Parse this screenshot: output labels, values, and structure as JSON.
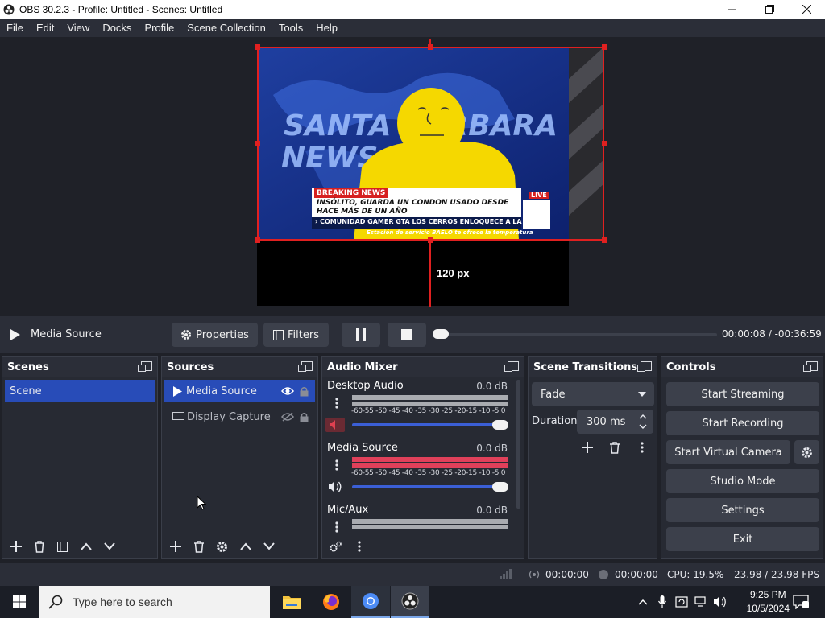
{
  "window": {
    "title": "OBS 30.2.3 - Profile: Untitled - Scenes: Untitled"
  },
  "menu": [
    "File",
    "Edit",
    "View",
    "Docks",
    "Profile",
    "Scene Collection",
    "Tools",
    "Help"
  ],
  "preview": {
    "distance_label": "120 px",
    "scene_text": {
      "headline1": "SANTA BARBARA",
      "headline2": "NEWS",
      "breaking": "BREAKING NEWS",
      "ticker1": "INSÓLITO, GUARDA UN CONDON USADO DESDE",
      "ticker2": "HACE MÁS DE UN AÑO",
      "ticker3": "› COMUNIDAD GAMER  GTA LOS CERROS ENLOQUECE A LA COM",
      "live": "LIVE",
      "sponsor": "Estación de servicio  BAELO  te ofrece la temperatura"
    }
  },
  "media_bar": {
    "source_name": "Media Source",
    "properties_label": "Properties",
    "filters_label": "Filters",
    "time": "00:00:08  /  -00:36:59",
    "progress": 0.0036
  },
  "scenes": {
    "title": "Scenes",
    "items": [
      "Scene"
    ]
  },
  "sources": {
    "title": "Sources",
    "items": [
      "Media Source",
      "Display Capture"
    ]
  },
  "audio_mixer": {
    "title": "Audio Mixer",
    "ticks": "-60-55 -50 -45 -40 -35 -30 -25 -20-15 -10 -5  0",
    "channels": [
      {
        "name": "Desktop Audio",
        "db": "0.0 dB",
        "muted": true,
        "volume": 1.0
      },
      {
        "name": "Media Source",
        "db": "0.0 dB",
        "muted": false,
        "volume": 1.0
      },
      {
        "name": "Mic/Aux",
        "db": "0.0 dB",
        "muted": false,
        "volume": 1.0
      }
    ]
  },
  "transitions": {
    "title": "Scene Transitions",
    "selected": "Fade",
    "duration_label": "Duration",
    "duration_value": "300 ms"
  },
  "controls": {
    "title": "Controls",
    "start_streaming": "Start Streaming",
    "start_recording": "Start Recording",
    "start_virtual_camera": "Start Virtual Camera",
    "studio_mode": "Studio Mode",
    "settings": "Settings",
    "exit": "Exit"
  },
  "status": {
    "stream_time": "00:00:00",
    "record_time": "00:00:00",
    "cpu": "CPU: 19.5%",
    "fps": "23.98 / 23.98 FPS"
  },
  "taskbar": {
    "search_placeholder": "Type here to search",
    "time": "9:25 PM",
    "date": "10/5/2024"
  },
  "colors": {
    "accent": "#284cb8",
    "selection": "#e02020",
    "meter_active": "#e0405a"
  }
}
